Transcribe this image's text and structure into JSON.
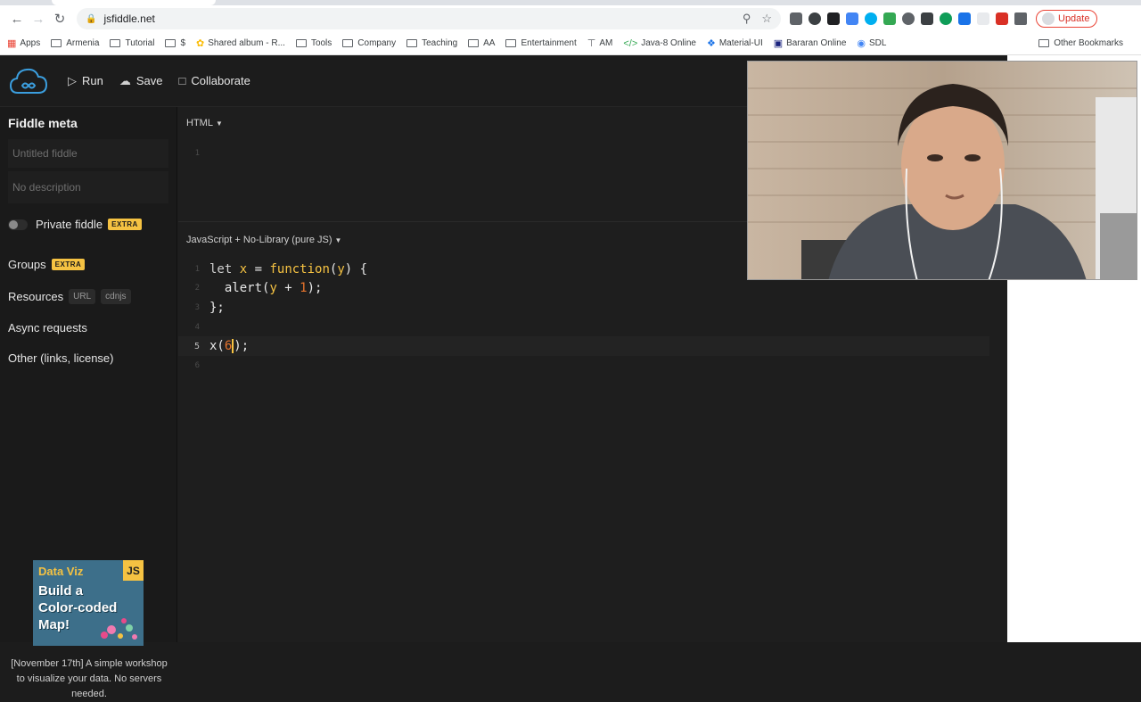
{
  "browser": {
    "url": "jsfiddle.net",
    "update_label": "Update",
    "bookmarks": [
      "Apps",
      "Armenia",
      "Tutorial",
      "$",
      "Shared album - R...",
      "Tools",
      "Company",
      "Teaching",
      "AA",
      "Entertainment",
      "AM",
      "Java-8 Online",
      "Material-UI",
      "Bararan Online",
      "SDL"
    ],
    "other_bookmarks": "Other Bookmarks"
  },
  "header": {
    "run_label": "Run",
    "save_label": "Save",
    "collaborate_label": "Collaborate"
  },
  "sidebar": {
    "title": "Fiddle meta",
    "title_placeholder": "Untitled fiddle",
    "description_placeholder": "No description",
    "private_label": "Private fiddle",
    "extra_badge": "EXTRA",
    "groups_label": "Groups",
    "resources_label": "Resources",
    "resources_chips": [
      "URL",
      "cdnjs"
    ],
    "async_label": "Async requests",
    "other_label": "Other (links, license)",
    "ad": {
      "title": "Data Viz",
      "badge": "JS",
      "body_lines": [
        "Build a",
        "Color-coded",
        "Map!"
      ],
      "caption": "[November 17th] A simple workshop to visualize your data. No servers needed."
    }
  },
  "html_panel": {
    "label": "HTML",
    "line_numbers": [
      "1"
    ]
  },
  "js_panel": {
    "label": "JavaScript + No-Library (pure JS)",
    "line_numbers": [
      "1",
      "2",
      "3",
      "4",
      "5",
      "6"
    ],
    "current_line": 5
  },
  "colors": {
    "accent": "#f5c242",
    "number": "#e8742c",
    "background": "#1e1e1e"
  }
}
